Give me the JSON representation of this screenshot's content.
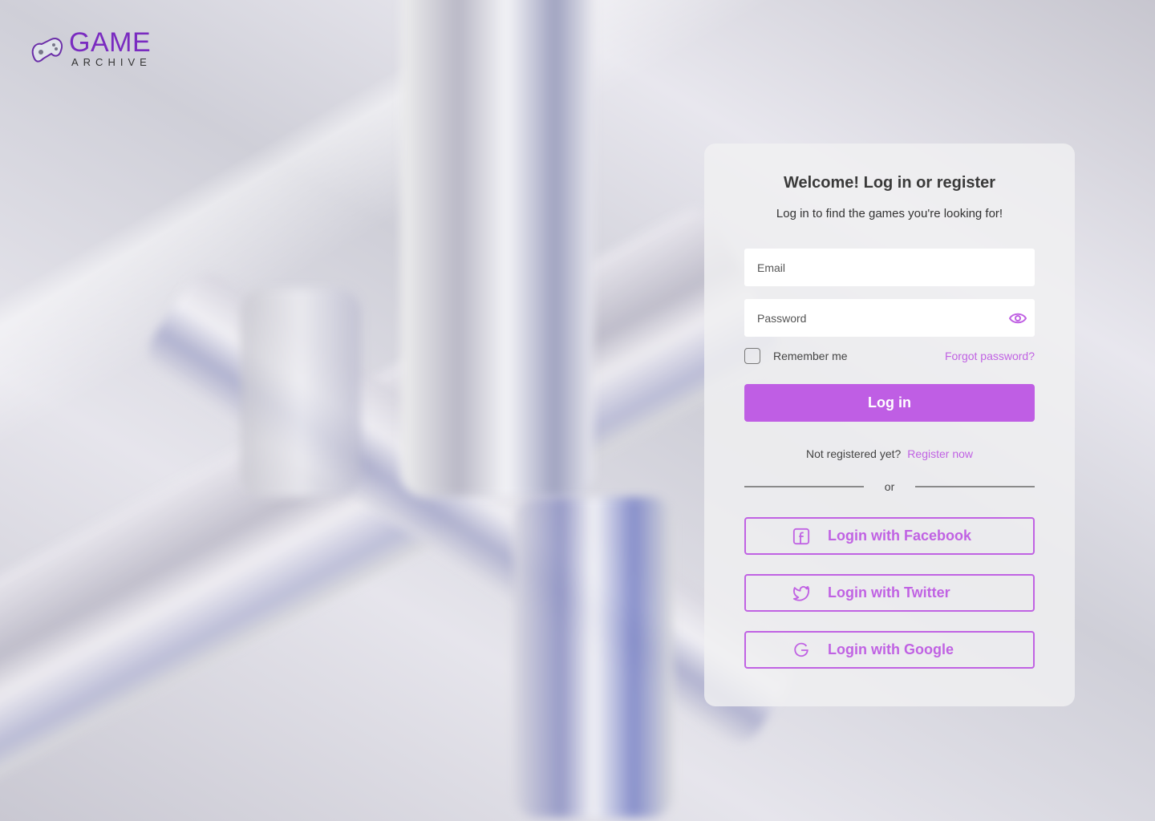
{
  "brand": {
    "name": "GAME",
    "tagline": "ARCHIVE",
    "accent": "#bf5ee4"
  },
  "card": {
    "title": "Welcome! Log in or register",
    "subtitle": "Log in to find the games you're looking for!",
    "email": {
      "placeholder": "Email",
      "value": ""
    },
    "password": {
      "placeholder": "Password",
      "value": ""
    },
    "remember_label": "Remember me",
    "forgot_label": "Forgot password?",
    "login_label": "Log in",
    "not_registered": "Not registered yet?",
    "register_label": "Register now",
    "or_label": "or",
    "social": [
      {
        "label": "Login with Facebook",
        "icon": "facebook-icon"
      },
      {
        "label": "Login with Twitter",
        "icon": "twitter-icon"
      },
      {
        "label": "Login with Google",
        "icon": "google-icon"
      }
    ]
  }
}
